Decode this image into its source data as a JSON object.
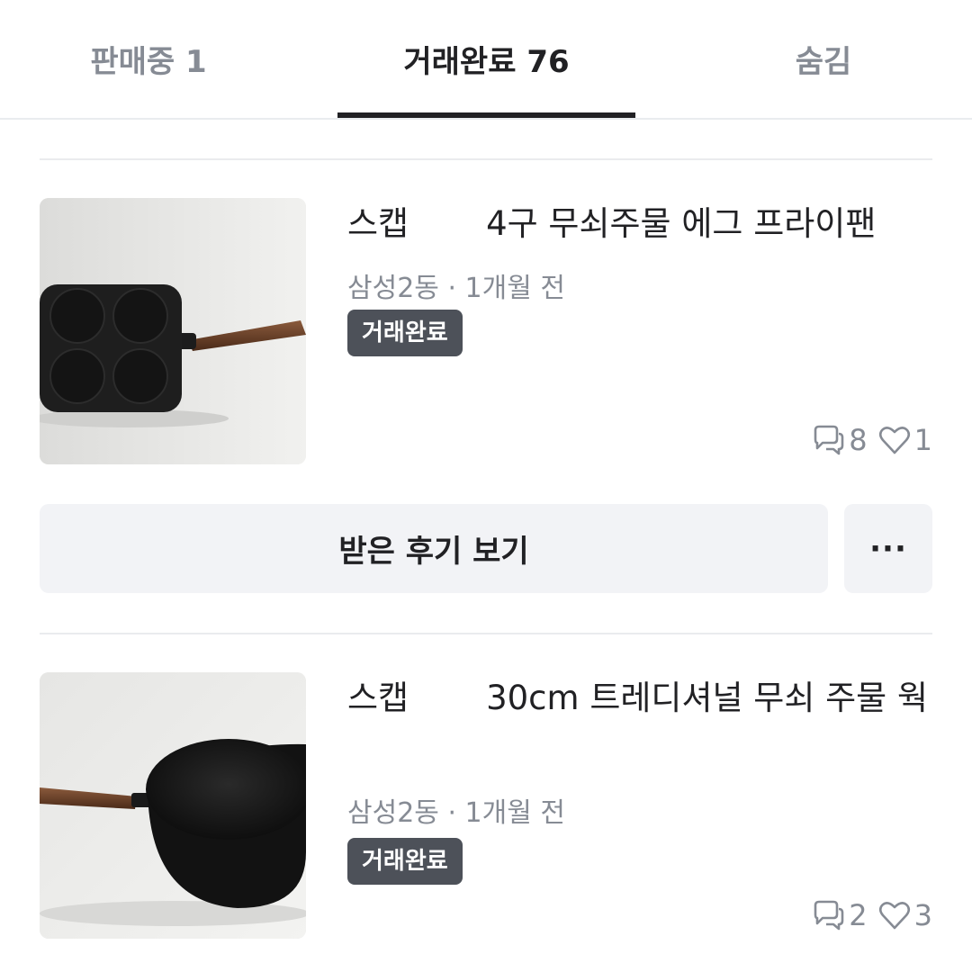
{
  "tabs": [
    {
      "label": "판매중 1"
    },
    {
      "label": "거래완료 76"
    },
    {
      "label": "숨김"
    }
  ],
  "items": [
    {
      "title_brand": "스캡",
      "title_rest": "4구 무쇠주물 에그 프라이팬",
      "location": "삼성2동",
      "separator": "·",
      "time": "1개월 전",
      "status": "거래완료",
      "comments": "8",
      "likes": "1",
      "thumb_icon": "four-hole-egg-pan"
    },
    {
      "title_brand": "스캡",
      "title_rest": "30cm 트레디셔널 무쇠 주물 웍",
      "location": "삼성2동",
      "separator": "·",
      "time": "1개월 전",
      "status": "거래완료",
      "comments": "2",
      "likes": "3",
      "thumb_icon": "cast-iron-wok"
    }
  ],
  "actions": {
    "review_label": "받은 후기 보기",
    "more_label": "···"
  },
  "icons": {
    "comment": "chat-bubble-icon",
    "like": "heart-icon"
  },
  "colors": {
    "text": "#212124",
    "muted": "#868b94",
    "badge_bg": "#4d5159",
    "button_bg": "#f2f3f6"
  }
}
